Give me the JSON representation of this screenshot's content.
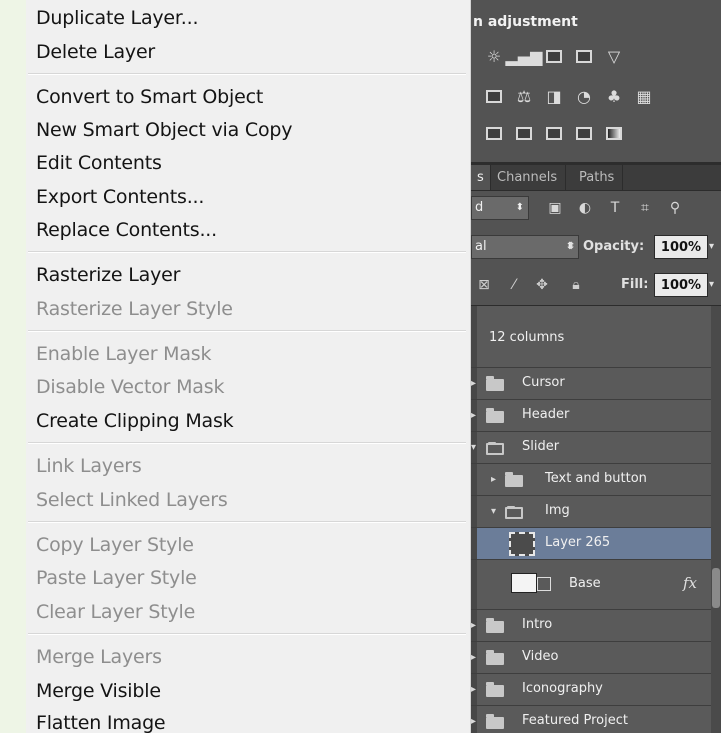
{
  "context_menu": {
    "items": [
      {
        "label": "Duplicate Layer...",
        "enabled": true
      },
      {
        "label": "Delete Layer",
        "enabled": true
      },
      {
        "label": "Convert to Smart Object",
        "enabled": true
      },
      {
        "label": "New Smart Object via Copy",
        "enabled": true
      },
      {
        "label": "Edit Contents",
        "enabled": true
      },
      {
        "label": "Export Contents...",
        "enabled": true
      },
      {
        "label": "Replace Contents...",
        "enabled": true
      },
      {
        "label": "Rasterize Layer",
        "enabled": true
      },
      {
        "label": "Rasterize Layer Style",
        "enabled": false
      },
      {
        "label": "Enable Layer Mask",
        "enabled": false
      },
      {
        "label": "Disable Vector Mask",
        "enabled": false
      },
      {
        "label": "Create Clipping Mask",
        "enabled": true
      },
      {
        "label": "Link Layers",
        "enabled": false
      },
      {
        "label": "Select Linked Layers",
        "enabled": false
      },
      {
        "label": "Copy Layer Style",
        "enabled": false
      },
      {
        "label": "Paste Layer Style",
        "enabled": false
      },
      {
        "label": "Clear Layer Style",
        "enabled": false
      },
      {
        "label": "Merge Layers",
        "enabled": false
      },
      {
        "label": "Merge Visible",
        "enabled": true
      },
      {
        "label": "Flatten Image",
        "enabled": true
      }
    ]
  },
  "adjustments": {
    "title": "n adjustment",
    "row1_icons": [
      "brightness-icon",
      "levels-icon",
      "curves-icon",
      "exposure-icon",
      "gradient-triangle-icon"
    ],
    "row2_icons": [
      "vibrance-icon",
      "color-balance-icon",
      "black-white-icon",
      "photo-filter-icon",
      "channel-mixer-icon",
      "color-lookup-icon"
    ],
    "row3_icons": [
      "invert-icon",
      "posterize-icon",
      "threshold-icon",
      "selective-color-icon",
      "gradient-map-icon"
    ]
  },
  "layers_panel": {
    "tabs": [
      {
        "label": "s",
        "active": true
      },
      {
        "label": "Channels",
        "active": false
      },
      {
        "label": "Paths",
        "active": false
      }
    ],
    "filter_kind": "d",
    "filter_icons": [
      "pixel-filter-icon",
      "adjustment-filter-icon",
      "type-filter-icon",
      "shape-filter-icon",
      "smart-filter-icon"
    ],
    "blend_mode": "al",
    "opacity_label": "Opacity:",
    "opacity_value": "100%",
    "lock_icons": [
      "lock-pixels-icon",
      "lock-brush-icon",
      "lock-move-icon",
      "lock-all-icon"
    ],
    "fill_label": "Fill:",
    "fill_value": "100%",
    "layers": [
      {
        "name": "12 columns",
        "kind": "partial"
      },
      {
        "name": "Cursor",
        "kind": "folder"
      },
      {
        "name": "Header",
        "kind": "folder"
      },
      {
        "name": "Slider",
        "kind": "folder-open"
      },
      {
        "name": "Text and button",
        "kind": "folder"
      },
      {
        "name": "Img",
        "kind": "folder-open"
      },
      {
        "name": "Layer 265",
        "kind": "smart-object",
        "selected": true
      },
      {
        "name": "Base",
        "kind": "layer-fx",
        "fx": "fx"
      },
      {
        "name": "Intro",
        "kind": "folder"
      },
      {
        "name": "Video",
        "kind": "folder"
      },
      {
        "name": "Iconography",
        "kind": "folder"
      },
      {
        "name": "Featured Project",
        "kind": "folder"
      }
    ]
  }
}
